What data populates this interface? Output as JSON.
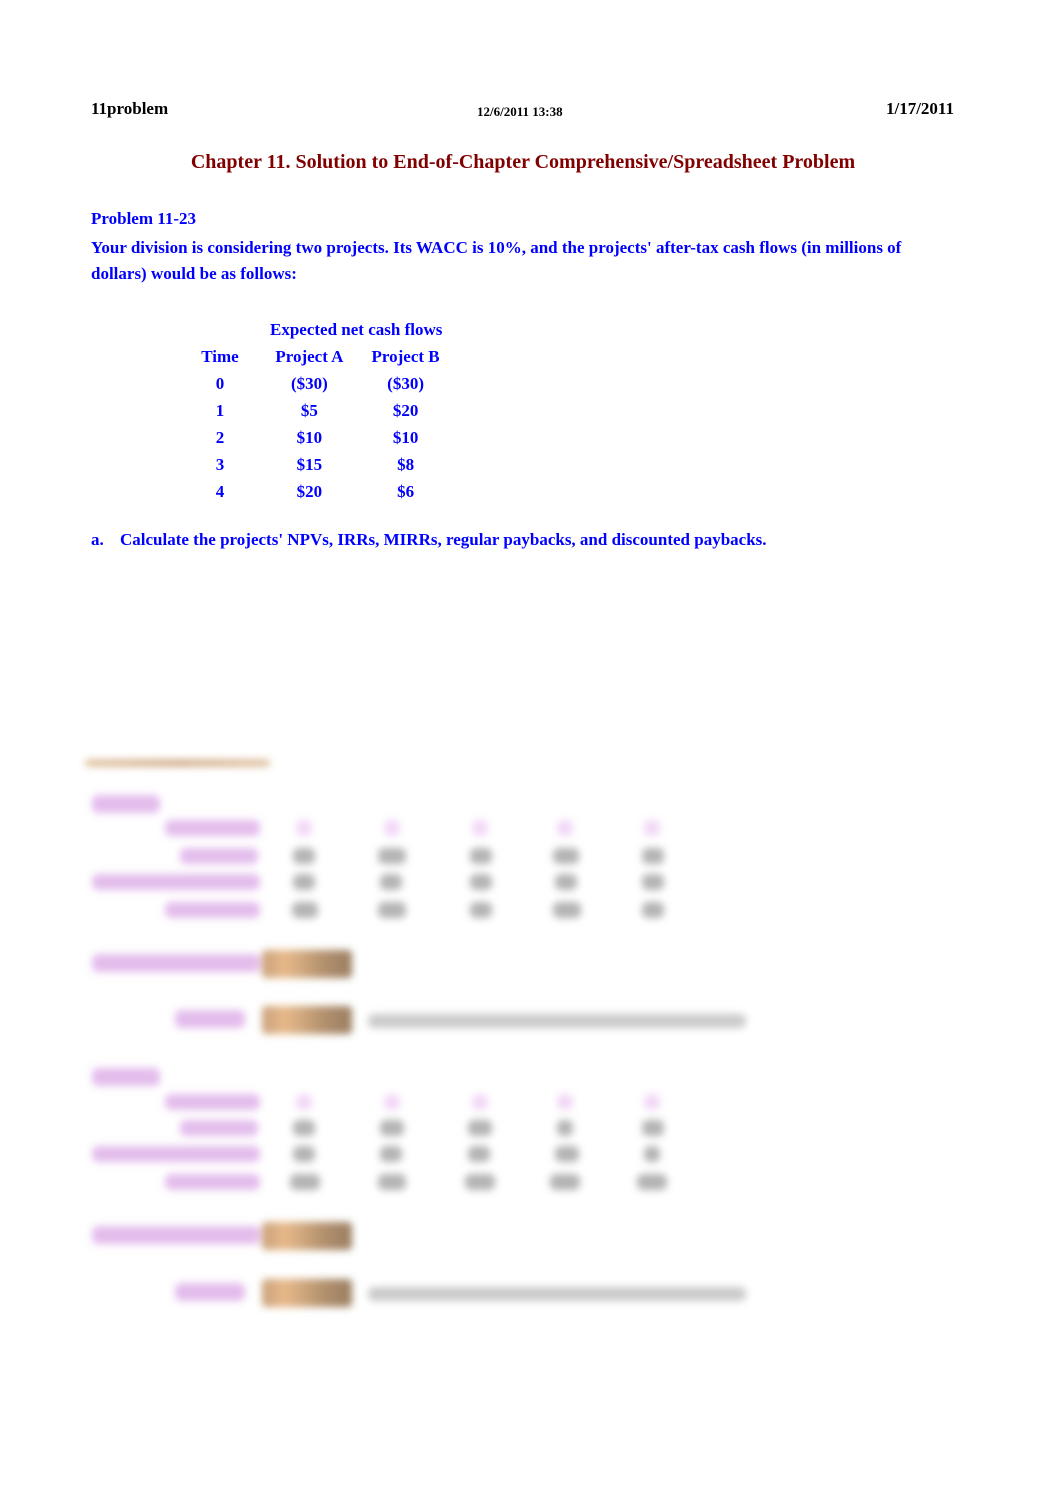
{
  "header": {
    "sheet_name": "11problem",
    "printed_timestamp": "12/6/2011 13:38",
    "date": "1/17/2011"
  },
  "title": "Chapter 11.  Solution to End-of-Chapter Comprehensive/Spreadsheet Problem",
  "problem": {
    "number_label": "Problem 11-23",
    "description": "Your division is considering two projects.  Its WACC is 10%, and the projects' after-tax cash flows (in millions of dollars) would be as follows:"
  },
  "cash_flow_table": {
    "group_header": "Expected net cash flows",
    "columns": [
      "Time",
      "Project A",
      "Project B"
    ],
    "rows": [
      [
        "0",
        "($30)",
        "($30)"
      ],
      [
        "1",
        "$5",
        "$20"
      ],
      [
        "2",
        "$10",
        "$10"
      ],
      [
        "3",
        "$15",
        "$8"
      ],
      [
        "4",
        "$20",
        "$6"
      ]
    ]
  },
  "question_a": {
    "label": "a.",
    "text": "Calculate the projects' NPVs, IRRs, MIRRs, regular paybacks, and discounted paybacks."
  },
  "obscured_section": {
    "state": "blurred"
  }
}
